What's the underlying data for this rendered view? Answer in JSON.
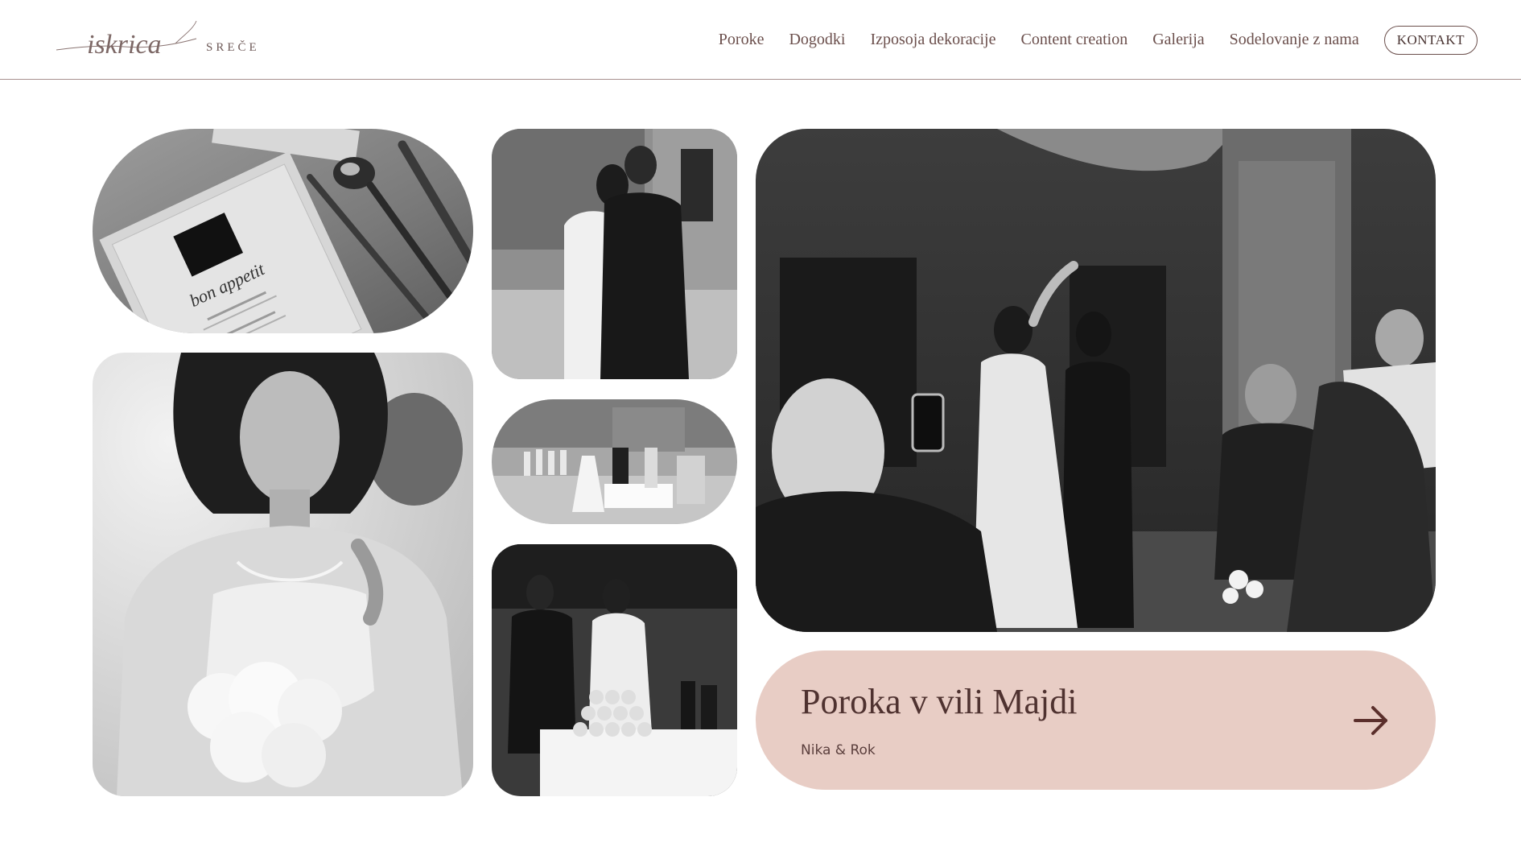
{
  "header": {
    "logo": {
      "script_text": "iskrica",
      "word_text": "SREČE"
    },
    "nav": [
      {
        "label": "Poroke"
      },
      {
        "label": "Dogodki"
      },
      {
        "label": "Izposoja dekoracije"
      },
      {
        "label": "Content creation"
      },
      {
        "label": "Galerija"
      },
      {
        "label": "Sodelovanje z nama"
      }
    ],
    "cta_label": "KONTAKT"
  },
  "feature": {
    "title": "Poroka v vili Majdi",
    "subtitle": "Nika & Rok",
    "arrow_icon": "arrow-right-icon"
  },
  "photos": {
    "menu_card_text": "bon appetit"
  },
  "colors": {
    "accent_text": "#6b4f4c",
    "card_background": "#e8cdc5",
    "divider": "#a8918f"
  }
}
